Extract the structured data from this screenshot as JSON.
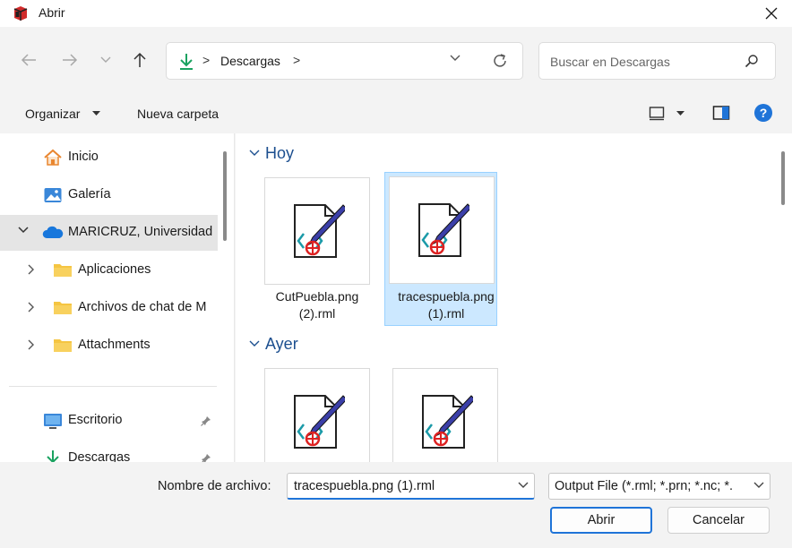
{
  "window": {
    "title": "Abrir",
    "icon": "app-icon",
    "close_icon": "close-icon"
  },
  "nav": {
    "back_icon": "back-arrow-icon",
    "forward_icon": "forward-arrow-icon",
    "recent_icon": "chevron-down-icon",
    "up_icon": "up-arrow-icon",
    "address": {
      "location_icon": "download-icon",
      "segment": "Descargas",
      "separator": ">",
      "dropdown_icon": "chevron-down-icon",
      "refresh_icon": "refresh-icon"
    },
    "search": {
      "placeholder": "Buscar en Descargas",
      "icon": "search-icon"
    }
  },
  "toolbar": {
    "organize_label": "Organizar",
    "new_folder_label": "Nueva carpeta",
    "view_icon": "view-icon",
    "preview_icon": "preview-pane-icon",
    "help_label": "?"
  },
  "sidebar": {
    "items": [
      {
        "label": "Inicio",
        "icon": "home-icon"
      },
      {
        "label": "Galería",
        "icon": "gallery-icon"
      },
      {
        "label": "MARICRUZ, Universidad",
        "icon": "cloud-icon",
        "expanded": true,
        "selected": true
      },
      {
        "label": "Aplicaciones",
        "icon": "folder-icon"
      },
      {
        "label": "Archivos de chat de M",
        "icon": "folder-icon"
      },
      {
        "label": "Attachments",
        "icon": "folder-icon"
      },
      {
        "label": "Escritorio",
        "icon": "desktop-icon",
        "pinned": true
      },
      {
        "label": "Descargas",
        "icon": "download-icon",
        "pinned": true
      }
    ]
  },
  "content": {
    "groups": [
      {
        "label": "Hoy",
        "files": [
          {
            "name": "CutPuebla.png (2).rml",
            "line1": "CutPuebla.png",
            "line2": "(2).rml",
            "selected": false
          },
          {
            "name": "tracespuebla.png (1).rml",
            "line1": "tracespuebla.png",
            "line2": "(1).rml",
            "selected": true
          }
        ]
      },
      {
        "label": "Ayer",
        "files": [
          {
            "name": "",
            "line1": "",
            "line2": "",
            "selected": false
          },
          {
            "name": "",
            "line1": "",
            "line2": "",
            "selected": false
          }
        ]
      }
    ]
  },
  "footer": {
    "filename_label": "Nombre de archivo:",
    "filename_value": "tracespuebla.png (1).rml",
    "filetype_value": "Output File (*.rml; *.prn; *.nc; *.",
    "open_label": "Abrir",
    "cancel_label": "Cancelar"
  },
  "colors": {
    "accent": "#1f74d8",
    "selection": "#cce8ff",
    "group_header": "#1c4f8f",
    "folder": "#f5c542"
  }
}
